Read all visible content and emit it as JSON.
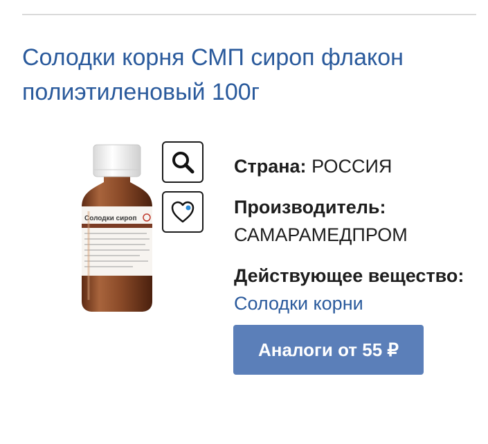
{
  "product": {
    "title": "Солодки корня СМП сироп флакон полиэтиленовый 100г",
    "image_label": "Солодки сироп"
  },
  "specs": {
    "country_label": "Страна:",
    "country_value": "РОССИЯ",
    "manufacturer_label": "Производитель:",
    "manufacturer_value": "САМАРАМЕДПРОМ",
    "substance_label": "Действующее вещество:",
    "substance_value": "Солодки корни"
  },
  "actions": {
    "analogs_button": "Аналоги от 55 ₽"
  },
  "colors": {
    "title": "#2a5a9c",
    "button": "#5b7fb9",
    "bottle": "#8a4a28"
  },
  "icons": [
    "search-icon",
    "heart-icon"
  ]
}
